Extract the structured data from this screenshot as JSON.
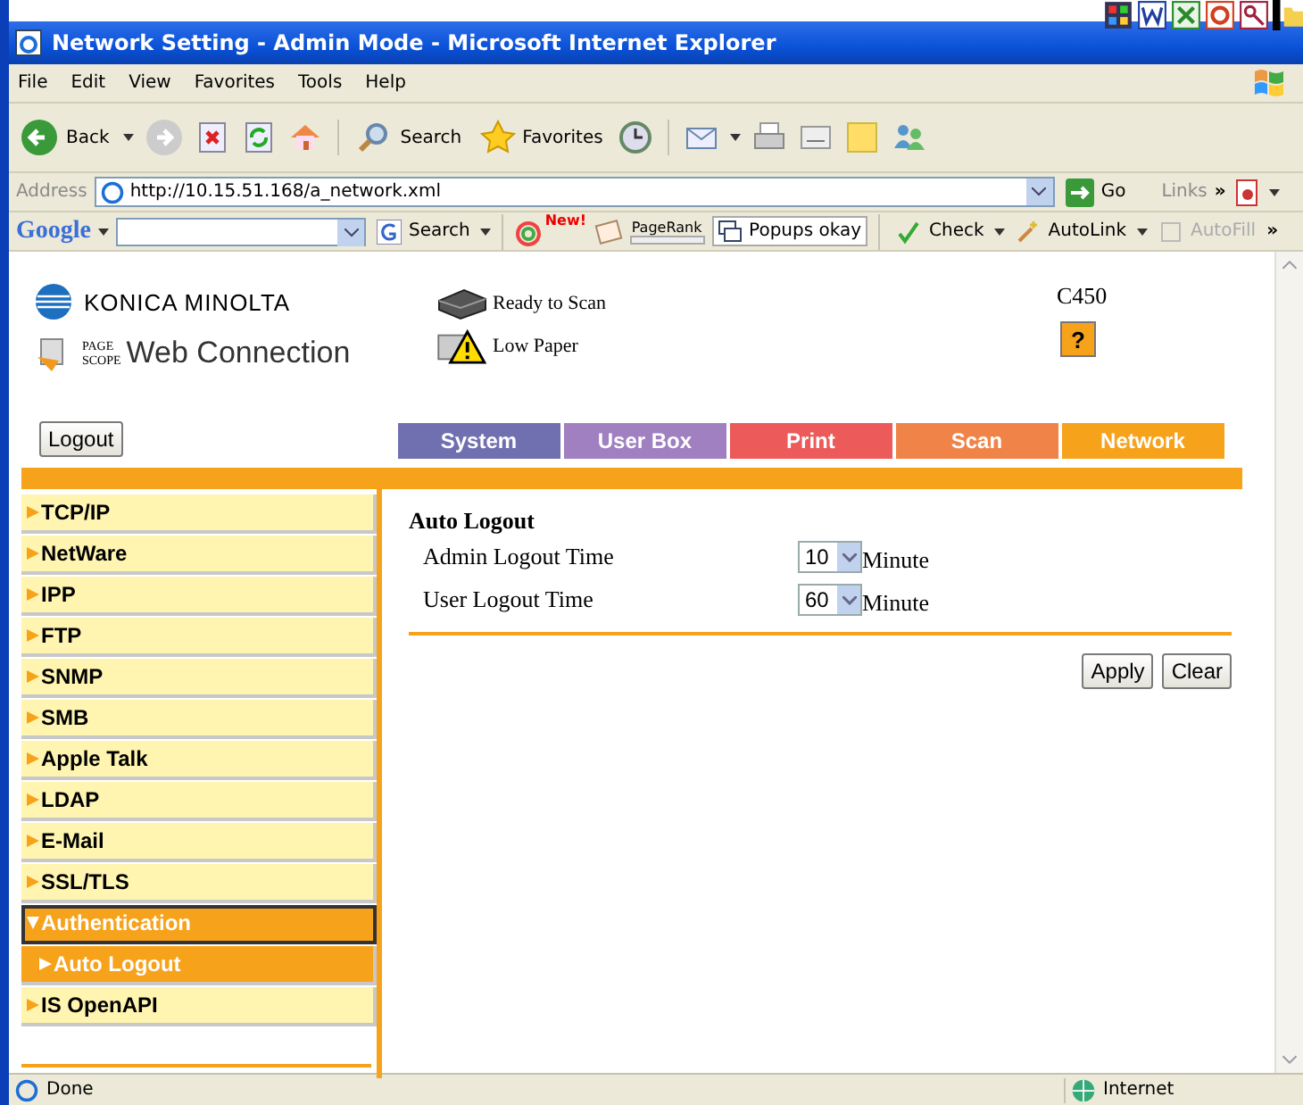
{
  "window": {
    "title": "Network Setting - Admin Mode - Microsoft Internet Explorer"
  },
  "menu": [
    "File",
    "Edit",
    "View",
    "Favorites",
    "Tools",
    "Help"
  ],
  "toolbar": {
    "back": "Back",
    "search": "Search",
    "favorites": "Favorites"
  },
  "address": {
    "label": "Address",
    "value": "http://10.15.51.168/a_network.xml",
    "go": "Go",
    "links": "Links",
    "more": "»"
  },
  "google_bar": {
    "logo": "Google",
    "search": "Search",
    "new_badge": "New!",
    "pagerank": "PageRank",
    "popups": "Popups okay",
    "check": "Check",
    "autolink": "AutoLink",
    "autofill": "AutoFill",
    "more": "»"
  },
  "header": {
    "brand": "KONICA MINOLTA",
    "product_small": [
      "PAGE",
      "SCOPE"
    ],
    "product": "Web Connection",
    "statuses": [
      {
        "kind": "printer",
        "text": "Ready to Scan"
      },
      {
        "kind": "warning",
        "text": "Low Paper"
      }
    ],
    "model": "C450",
    "help": "?",
    "logout": "Logout"
  },
  "tabs": [
    {
      "label": "System",
      "color": "#7070b0"
    },
    {
      "label": "User Box",
      "color": "#a080c0"
    },
    {
      "label": "Print",
      "color": "#ec5a5a"
    },
    {
      "label": "Scan",
      "color": "#f08448"
    },
    {
      "label": "Network",
      "color": "#f7a21b"
    }
  ],
  "sidebar": {
    "items": [
      {
        "label": "TCP/IP",
        "selected": false,
        "expanded": false
      },
      {
        "label": "NetWare",
        "selected": false,
        "expanded": false
      },
      {
        "label": "IPP",
        "selected": false,
        "expanded": false
      },
      {
        "label": "FTP",
        "selected": false,
        "expanded": false
      },
      {
        "label": "SNMP",
        "selected": false,
        "expanded": false
      },
      {
        "label": "SMB",
        "selected": false,
        "expanded": false
      },
      {
        "label": "Apple Talk",
        "selected": false,
        "expanded": false
      },
      {
        "label": "LDAP",
        "selected": false,
        "expanded": false
      },
      {
        "label": "E-Mail",
        "selected": false,
        "expanded": false
      },
      {
        "label": "SSL/TLS",
        "selected": false,
        "expanded": false
      },
      {
        "label": "Authentication",
        "selected": true,
        "expanded": true,
        "children": [
          {
            "label": "Auto Logout",
            "selected": true
          }
        ]
      },
      {
        "label": "IS OpenAPI",
        "selected": false,
        "expanded": false
      }
    ]
  },
  "form": {
    "title": "Auto Logout",
    "fields": [
      {
        "label": "Admin Logout Time",
        "value": "10",
        "unit": "Minute"
      },
      {
        "label": "User Logout Time",
        "value": "60",
        "unit": "Minute"
      }
    ],
    "buttons": [
      "Apply",
      "Clear"
    ]
  },
  "status_bar": {
    "text": "Done",
    "zone": "Internet"
  }
}
